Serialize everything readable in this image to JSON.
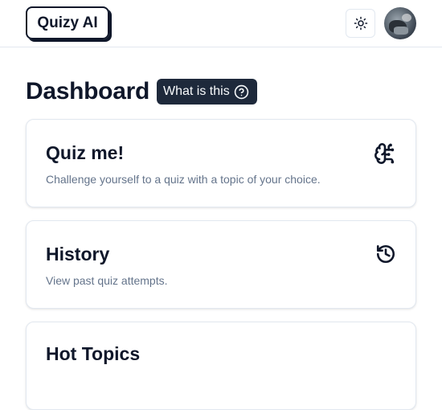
{
  "navbar": {
    "logo": "Quizy AI",
    "theme_icon": "sun-icon",
    "avatar_icon": "user-avatar"
  },
  "dashboard": {
    "title": "Dashboard",
    "help_button": "What is this",
    "help_icon": "help-circle-icon"
  },
  "cards": {
    "quiz": {
      "title": "Quiz me!",
      "description": "Challenge yourself to a quiz with a topic of your choice.",
      "icon": "brain-circuit-icon"
    },
    "history": {
      "title": "History",
      "description": "View past quiz attempts.",
      "icon": "history-icon"
    },
    "hot_topics": {
      "title": "Hot Topics"
    }
  },
  "colors": {
    "text": "#0f172a",
    "muted": "#64748b",
    "badge_bg": "#1e293b",
    "border": "#e2e8f0"
  }
}
